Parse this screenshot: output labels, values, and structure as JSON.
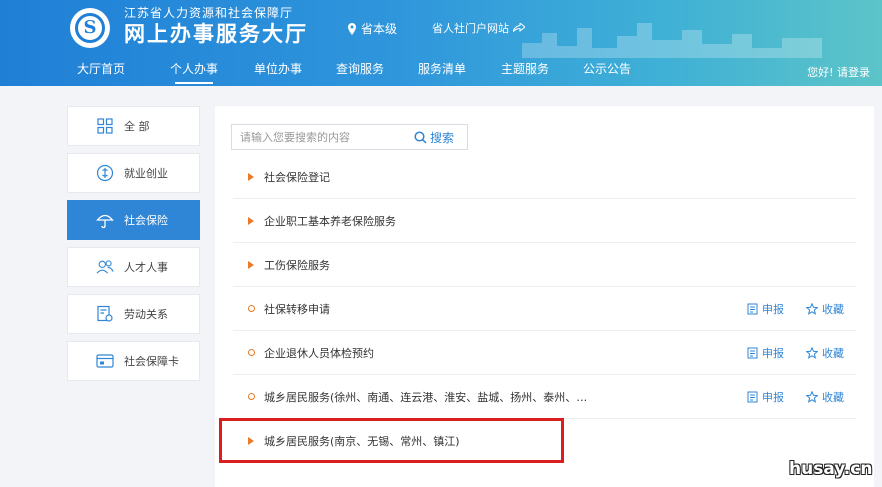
{
  "header": {
    "org_name": "江苏省人力资源和社会保障厅",
    "site_title": "网上办事服务大厅",
    "level": "省本级",
    "portal_link": "省人社门户网站",
    "greeting": "您好! 请登录"
  },
  "nav": [
    {
      "label": "大厅首页",
      "active": false
    },
    {
      "label": "个人办事",
      "active": true
    },
    {
      "label": "单位办事",
      "active": false
    },
    {
      "label": "查询服务",
      "active": false
    },
    {
      "label": "服务清单",
      "active": false
    },
    {
      "label": "主题服务",
      "active": false
    },
    {
      "label": "公示公告",
      "active": false
    }
  ],
  "sidebar": {
    "items": [
      {
        "label": "全 部",
        "icon": "grid-icon"
      },
      {
        "label": "就业创业",
        "icon": "employment-icon"
      },
      {
        "label": "社会保险",
        "icon": "umbrella-icon",
        "active": true
      },
      {
        "label": "人才人事",
        "icon": "people-icon"
      },
      {
        "label": "劳动关系",
        "icon": "document-icon"
      },
      {
        "label": "社会保障卡",
        "icon": "card-icon"
      }
    ]
  },
  "search": {
    "placeholder": "请输入您要搜索的内容",
    "button_label": "搜索"
  },
  "services": [
    {
      "label": "社会保险登记",
      "marker": "triangle"
    },
    {
      "label": "企业职工基本养老保险服务",
      "marker": "triangle"
    },
    {
      "label": "工伤保险服务",
      "marker": "triangle"
    },
    {
      "label": "社保转移申请",
      "marker": "ring",
      "apply": "申报",
      "favorite": "收藏"
    },
    {
      "label": "企业退休人员体检预约",
      "marker": "ring",
      "apply": "申报",
      "favorite": "收藏"
    },
    {
      "label": "城乡居民服务(徐州、南通、连云港、淮安、盐城、扬州、泰州、…",
      "marker": "ring",
      "apply": "申报",
      "favorite": "收藏"
    },
    {
      "label": "城乡居民服务(南京、无锡、常州、镇江)",
      "marker": "triangle"
    }
  ],
  "watermark": "husay.cn",
  "colors": {
    "primary": "#2f86d6",
    "marker": "#e87a2a",
    "highlight": "#d81e1e"
  }
}
